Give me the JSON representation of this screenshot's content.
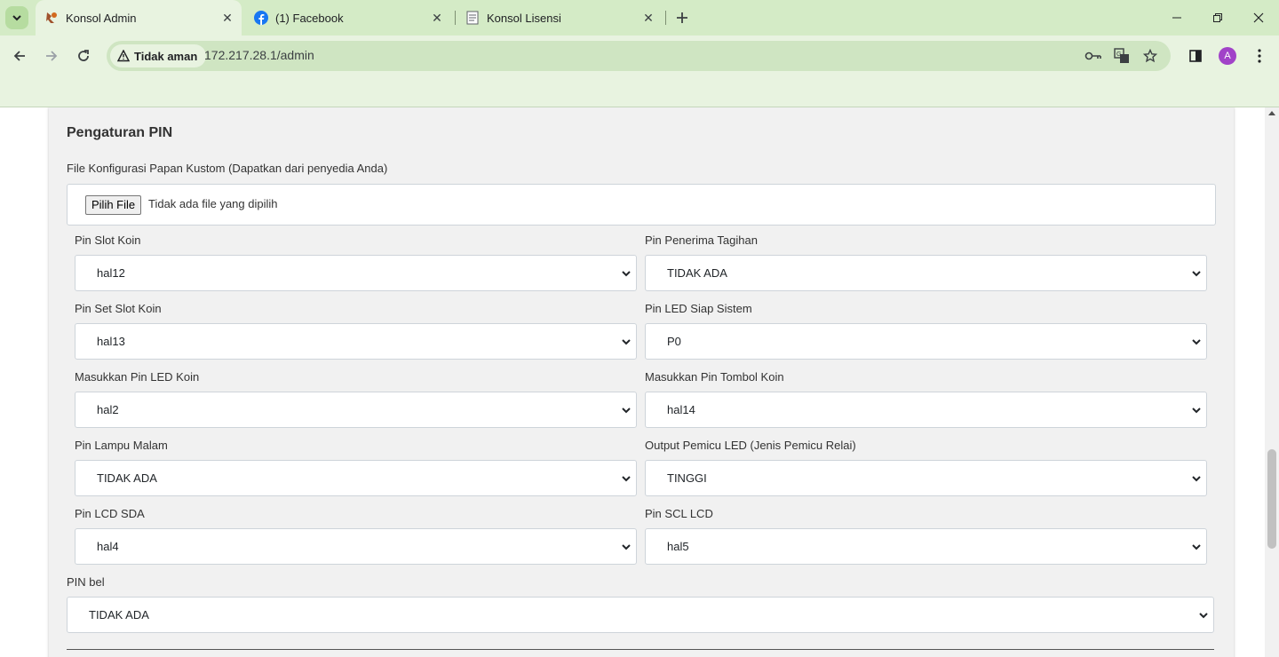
{
  "browser": {
    "tabs": [
      {
        "title": "Konsol Admin",
        "icon": "konsol-admin-favicon",
        "active": true
      },
      {
        "title": "(1) Facebook",
        "icon": "facebook-icon",
        "active": false
      },
      {
        "title": "Konsol Lisensi",
        "icon": "document-favicon",
        "active": false
      }
    ],
    "security_label": "Tidak aman",
    "url": "172.217.28.1/admin",
    "avatar_letter": "A",
    "accent_color": "#d4ebc6",
    "avatar_color": "#a142c8"
  },
  "page": {
    "section_title": "Pengaturan PIN",
    "file_config": {
      "label": "File Konfigurasi Papan Kustom (Dapatkan dari penyedia Anda)",
      "button": "Pilih File",
      "status": "Tidak ada file yang dipilih"
    },
    "fields": [
      {
        "label": "Pin Slot Koin",
        "value": "hal12"
      },
      {
        "label": "Pin Penerima Tagihan",
        "value": "TIDAK ADA"
      },
      {
        "label": "Pin Set Slot Koin",
        "value": "hal13"
      },
      {
        "label": "Pin LED Siap Sistem",
        "value": "P0"
      },
      {
        "label": "Masukkan Pin LED Koin",
        "value": "hal2"
      },
      {
        "label": "Masukkan Pin Tombol Koin",
        "value": "hal14"
      },
      {
        "label": "Pin Lampu Malam",
        "value": "TIDAK ADA"
      },
      {
        "label": "Output Pemicu LED (Jenis Pemicu Relai)",
        "value": "TINGGI"
      },
      {
        "label": "Pin LCD SDA",
        "value": "hal4"
      },
      {
        "label": "Pin SCL LCD",
        "value": "hal5"
      }
    ],
    "bell": {
      "label": "PIN bel",
      "value": "TIDAK ADA"
    }
  }
}
